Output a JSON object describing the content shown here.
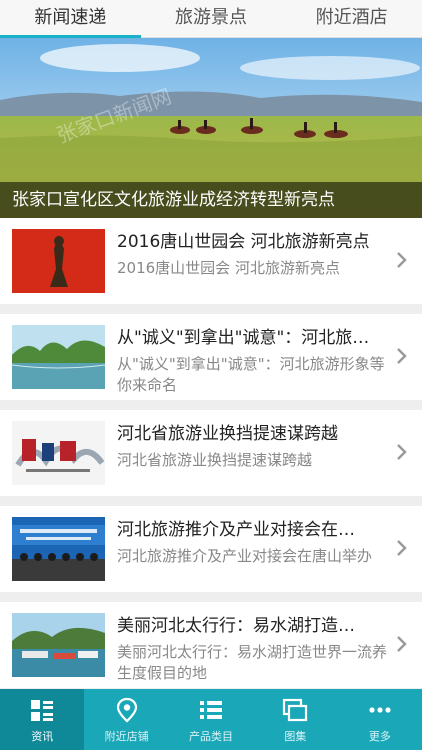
{
  "top_tabs": [
    {
      "label": "新闻速递",
      "active": true
    },
    {
      "label": "旅游景点",
      "active": false
    },
    {
      "label": "附近酒店",
      "active": false
    }
  ],
  "banner": {
    "caption": "张家口宣化区文化旅游业成经济转型新亮点",
    "watermark": "张家口新闻网"
  },
  "news": [
    {
      "title": "2016唐山世园会 河北旅游新亮点",
      "desc": "2016唐山世园会 河北旅游新亮点",
      "thumb": "sculpture-image"
    },
    {
      "title": "从\"诚义\"到拿出\"诚意\"：河北旅…",
      "desc": "从\"诚义\"到拿出\"诚意\"：河北旅游形象等你来命名",
      "thumb": "lake-image"
    },
    {
      "title": "河北省旅游业换挡提速谋跨越",
      "desc": "河北省旅游业换挡提速谋跨越",
      "thumb": "hebei-logo-image"
    },
    {
      "title": "河北旅游推介及产业对接会在…",
      "desc": "河北旅游推介及产业对接会在唐山举办",
      "thumb": "conference-image"
    },
    {
      "title": "美丽河北太行行：易水湖打造…",
      "desc": "美丽河北太行行：易水湖打造世界一流养生度假目的地",
      "thumb": "boats-image"
    }
  ],
  "bottom_nav": [
    {
      "label": "资讯",
      "icon": "grid-list-icon",
      "active": true
    },
    {
      "label": "附近店铺",
      "icon": "location-pin-icon",
      "active": false
    },
    {
      "label": "产品类目",
      "icon": "list-icon",
      "active": false
    },
    {
      "label": "图集",
      "icon": "gallery-icon",
      "active": false
    },
    {
      "label": "更多",
      "icon": "more-icon",
      "active": false
    }
  ],
  "colors": {
    "accent": "#1aa8b8",
    "nav_active": "#0f8898",
    "tab_underline": "#1ab2c8"
  }
}
